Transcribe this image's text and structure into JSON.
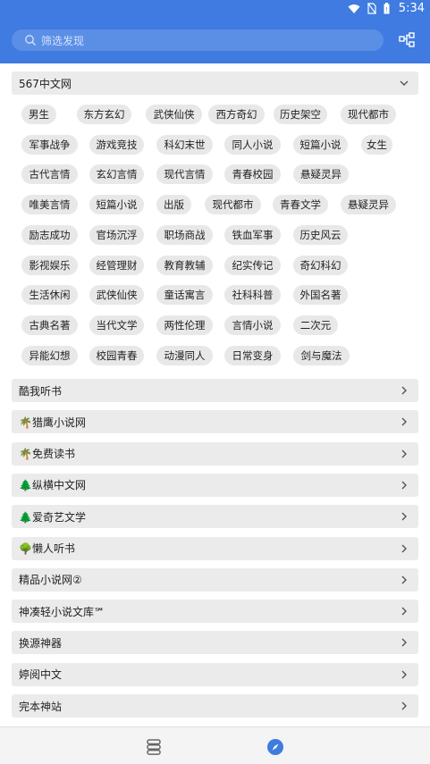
{
  "status": {
    "time": "5:34"
  },
  "search": {
    "placeholder": "筛选发现"
  },
  "first_group": {
    "title": "567中文网"
  },
  "tags": [
    "男生",
    "东方玄幻",
    "武侠仙侠",
    "西方奇幻",
    "历史架空",
    "现代都市",
    "军事战争",
    "游戏竞技",
    "科幻末世",
    "同人小说",
    "短篇小说",
    "女生",
    "古代言情",
    "玄幻言情",
    "现代言情",
    "青春校园",
    "悬疑灵异",
    "唯美言情",
    "短篇小说",
    "出版",
    "现代都市",
    "青春文学",
    "悬疑灵异",
    "励志成功",
    "官场沉浮",
    "职场商战",
    "铁血军事",
    "历史风云",
    "影视娱乐",
    "经管理财",
    "教育教辅",
    "纪实传记",
    "奇幻科幻",
    "生活休闲",
    "武侠仙侠",
    "童话寓言",
    "社科科普",
    "外国名著",
    "古典名著",
    "当代文学",
    "两性伦理",
    "言情小说",
    "二次元",
    "异能幻想",
    "校园青春",
    "动漫同人",
    "日常变身",
    "剑与魔法"
  ],
  "sources": [
    "酷我听书",
    "🌴猎鹰小说网",
    "🌴免费读书",
    "🌲纵横中文网",
    "🌲爱奇艺文学",
    "🌳懒人听书",
    "精品小说网②",
    "神凑轻小说文库℠",
    "换源神器",
    "婷阅中文",
    "完本神站"
  ],
  "colors": {
    "accent": "#3f7be0",
    "chip": "#e8e8e8",
    "header": "#ebebeb"
  },
  "icons": {
    "share": "share-nodes-icon",
    "bookshelf": "bookshelf-icon",
    "discover": "compass-icon"
  }
}
